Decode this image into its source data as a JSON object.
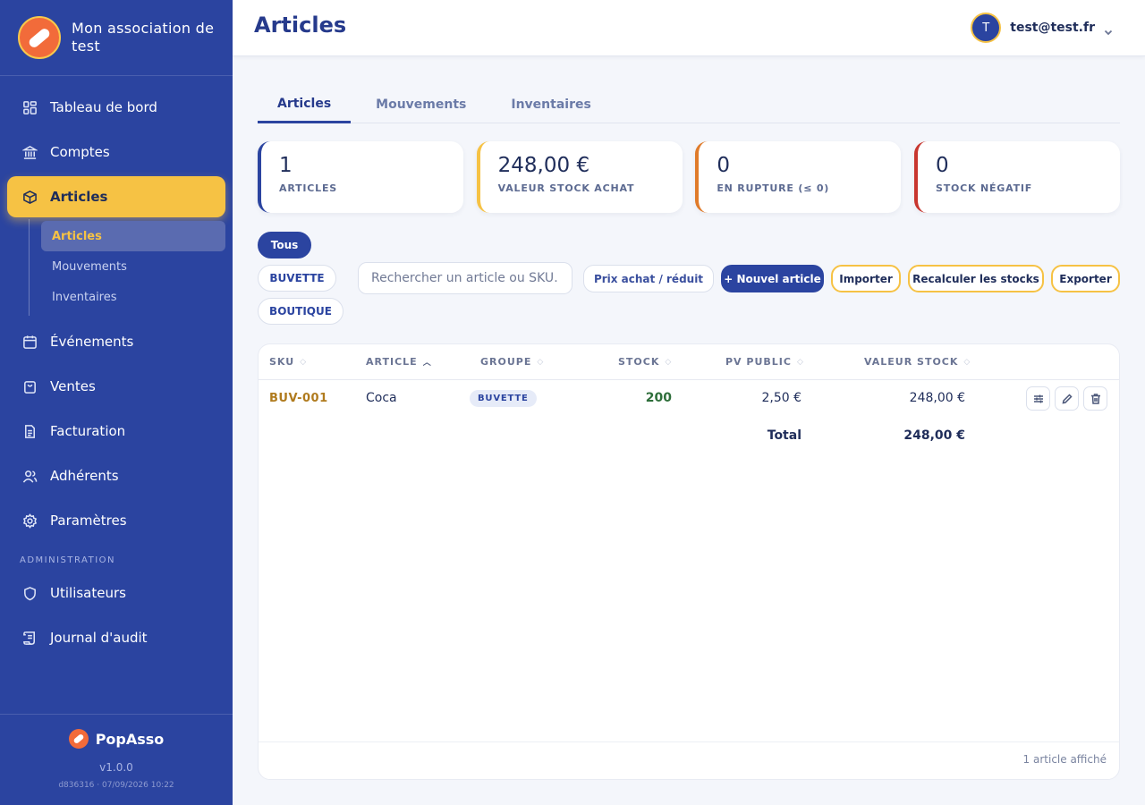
{
  "brand": {
    "name": "Mon association de test"
  },
  "nav": {
    "items": [
      {
        "label": "Tableau de bord",
        "icon": "dashboard-icon"
      },
      {
        "label": "Comptes",
        "icon": "bank-icon"
      },
      {
        "label": "Articles",
        "icon": "box-icon"
      }
    ],
    "sub_items": [
      "Articles",
      "Mouvements",
      "Inventaires"
    ],
    "items_after": [
      {
        "label": "Événements",
        "icon": "calendar-icon"
      },
      {
        "label": "Ventes",
        "icon": "bag-icon"
      },
      {
        "label": "Facturation",
        "icon": "document-icon"
      },
      {
        "label": "Adhérents",
        "icon": "users-icon"
      },
      {
        "label": "Paramètres",
        "icon": "gear-icon"
      }
    ],
    "admin_label": "ADMINISTRATION",
    "admin_items": [
      {
        "label": "Utilisateurs",
        "icon": "shield-icon"
      },
      {
        "label": "Journal d'audit",
        "icon": "scroll-icon"
      }
    ]
  },
  "footer": {
    "brand": "PopAsso",
    "version": "v1.0.0",
    "build": "d836316 · 07/09/2026 10:22"
  },
  "header": {
    "title": "Articles",
    "user_initial": "T",
    "user_email": "test@test.fr"
  },
  "tabs": [
    "Articles",
    "Mouvements",
    "Inventaires"
  ],
  "stats": [
    {
      "value": "1",
      "label": "ARTICLES",
      "color": "#2b44a0"
    },
    {
      "value": "248,00 €",
      "label": "VALEUR STOCK ACHAT",
      "color": "#f6c244"
    },
    {
      "value": "0",
      "label": "EN RUPTURE (≤ 0)",
      "color": "#e07b2a"
    },
    {
      "value": "0",
      "label": "STOCK NÉGATIF",
      "color": "#c8362e"
    }
  ],
  "filters": {
    "all": "Tous",
    "groups": [
      "BUVETTE",
      "BOUTIQUE"
    ],
    "search_placeholder": "Rechercher un article ou SKU…"
  },
  "toolbar": {
    "price_toggle": "Prix achat / réduit",
    "new_article": "+ Nouvel article",
    "import": "Importer",
    "recalc": "Recalculer les stocks",
    "export": "Exporter"
  },
  "table": {
    "columns": [
      "SKU",
      "ARTICLE",
      "GROUPE",
      "STOCK",
      "PV PUBLIC",
      "VALEUR STOCK"
    ],
    "rows": [
      {
        "sku": "BUV-001",
        "article": "Coca",
        "groupe": "BUVETTE",
        "stock": "200",
        "pv_public": "2,50 €",
        "valeur_stock": "248,00 €"
      }
    ],
    "total_label": "Total",
    "total_value": "248,00 €",
    "footer_text": "1 article affiché"
  }
}
